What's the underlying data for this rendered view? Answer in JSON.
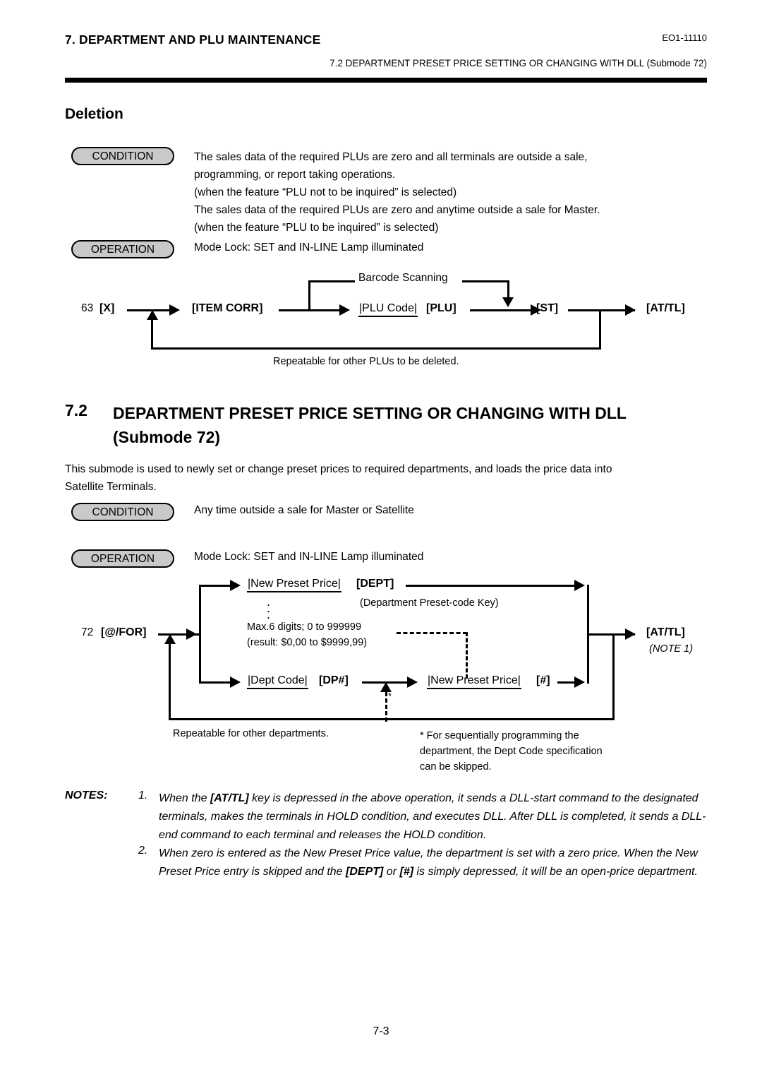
{
  "header": {
    "chapter": "7.   DEPARTMENT AND PLU MAINTENANCE",
    "doc_code": "EO1-11110",
    "running_head": "7.2  DEPARTMENT PRESET PRICE SETTING OR CHANGING WITH DLL (Submode 72)"
  },
  "deletion": {
    "heading": "Deletion",
    "condition_label": "CONDITION",
    "condition_text": "The sales data of the required PLUs are zero and all terminals are outside a sale,\nprogramming, or report taking operations.\n(when the feature “PLU not to be inquired” is selected)\nThe sales data of the required PLUs are zero and anytime outside a sale for Master.\n(when the feature “PLU to be inquired” is selected)",
    "operation_label": "OPERATION",
    "operation_text": "Mode Lock:  SET and IN-LINE Lamp illuminated",
    "flow": {
      "start": "63  [X]",
      "start_num": "63",
      "start_key": "[X]",
      "item_corr_key": "[ITEM CORR]",
      "barcode_label": "Barcode Scanning",
      "plu_code_field": "PLU Code",
      "plu_key": "[PLU]",
      "st_key": "[ST]",
      "attl_key": "[AT/TL]",
      "repeat_note": "Repeatable for other PLUs to be deleted."
    }
  },
  "section72": {
    "number": "7.2",
    "title": "DEPARTMENT PRESET PRICE SETTING OR CHANGING WITH DLL (Submode 72)",
    "title_line1": "DEPARTMENT PRESET PRICE SETTING OR CHANGING WITH DLL",
    "title_line2": "(Submode 72)",
    "intro": "This submode is used to newly set or change preset prices to required departments, and loads the price data into\nSatellite Terminals.",
    "condition_label": "CONDITION",
    "condition_text": "Any time outside a sale for Master or Satellite",
    "operation_label": "OPERATION",
    "operation_text": "Mode Lock:  SET and IN-LINE Lamp illuminated",
    "flow": {
      "start_num": "72",
      "start_key": "[@/FOR]",
      "new_preset_price_field": "New Preset Price",
      "dept_key": "[DEPT]",
      "dept_caption": "(Department Preset-code Key)",
      "vertical_dots": "⋮",
      "range_line1": "Max.6 digits;  0 to 999999",
      "range_line2": "(result:  $0,00 to $9999,99)",
      "dept_code_field": "Dept Code",
      "dp_key": "[DP#]",
      "new_preset_price_field2": "New Preset Price",
      "hash_key": "[#]",
      "attl_key": "[AT/TL]",
      "attl_note": "(NOTE 1)",
      "repeat_note": "Repeatable for other departments.",
      "asterisk": "*",
      "asterisk_note": "* For sequentially programming the\n   department, the Dept Code specification\n   can be skipped."
    }
  },
  "notes": {
    "label": "NOTES:",
    "items": [
      {
        "num": "1.",
        "text_pre": "When the ",
        "key1": "[AT/TL]",
        "text_post": " key is depressed in the above operation, it sends a DLL-start command to the designated terminals, makes the terminals in HOLD condition, and executes DLL.  After DLL is completed, it sends a DLL-end command to each terminal and releases the HOLD condition."
      },
      {
        "num": "2.",
        "text_pre": "When zero is entered as the New Preset Price value, the department is set with a zero price. When the New Preset Price entry is skipped and the ",
        "key1": "[DEPT]",
        "mid": " or ",
        "key2": "[#]",
        "text_post": " is simply depressed, it will be an open-price department."
      }
    ]
  },
  "footer": {
    "page": "7-3"
  },
  "colors": {
    "ink": "#000000",
    "pill_fill": "#c9c9c9",
    "page": "#ffffff"
  }
}
